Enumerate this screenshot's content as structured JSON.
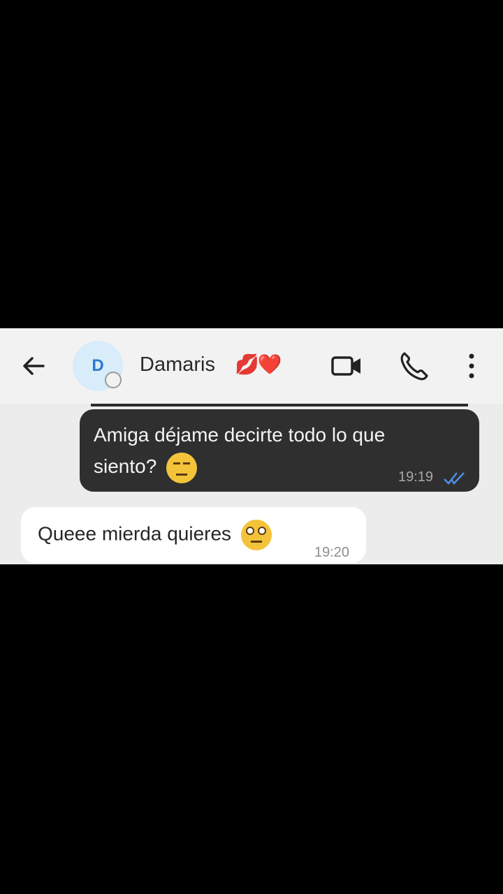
{
  "chat_header": {
    "contact_initial": "D",
    "contact_name": "Damaris",
    "contact_emoji": "💋❤️",
    "icons": {
      "back": "back-arrow-icon",
      "video": "video-camera-icon",
      "call": "phone-icon",
      "menu": "more-vert-icon"
    }
  },
  "messages": [
    {
      "direction": "outgoing",
      "text": "Amiga déjame decirte todo lo que siento?",
      "emoji": "😔",
      "time": "19:19",
      "status_icon": "double-check-icon"
    },
    {
      "direction": "incoming",
      "text": "Queee mierda quieres",
      "emoji": "🙄",
      "time": "19:20"
    }
  ],
  "colors": {
    "outgoing_bubble": "#2f2f2f",
    "incoming_bubble": "#ffffff",
    "read_ticks": "#4a90e2",
    "header_bg": "#f2f2f2"
  }
}
